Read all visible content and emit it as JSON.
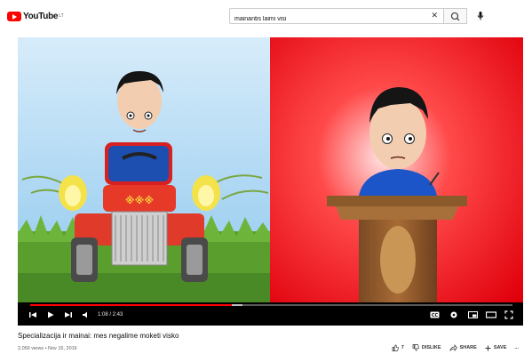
{
  "header": {
    "logo_text": "YouTube",
    "logo_country": "LT",
    "search_value": "mainantis laimi visi",
    "icons": [
      "youtube-logo",
      "clear-icon",
      "search-icon",
      "mic-icon"
    ]
  },
  "player": {
    "time": "1:08 / 2:43",
    "progress_fraction": 0.418,
    "loaded_fraction": 0.44,
    "icons": [
      "skip-back-icon",
      "play-icon",
      "skip-next-icon",
      "volume-icon",
      "cc-icon",
      "settings-icon",
      "miniplayer-icon",
      "theater-icon",
      "fullscreen-icon"
    ]
  },
  "video": {
    "title": "Specializacija ir mainai: mes negalime moketi visko",
    "meta": "2,056 views • Nov 16, 2016"
  },
  "actions": {
    "like_count": "7",
    "dislike_label": "DISLIKE",
    "share_label": "SHARE",
    "save_label": "SAVE",
    "more_label": "..."
  },
  "colors": {
    "brand": "#ff0000",
    "progress": "#ff0000"
  }
}
